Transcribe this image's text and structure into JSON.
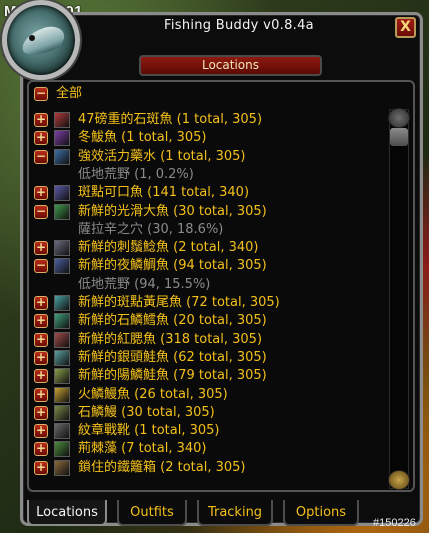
{
  "brand": "MOBILE01",
  "window": {
    "title": "Fishing Buddy v0.8.4a",
    "close_label": "X"
  },
  "header_bar": {
    "label": "Locations"
  },
  "top_group": {
    "toggle": "−",
    "label": "全部"
  },
  "rows": [
    {
      "toggle": "+",
      "label": "47磅重的石斑魚 (1 total, 305)",
      "icon_color": "#b23a3a"
    },
    {
      "toggle": "+",
      "label": "冬鮁魚 (1 total, 305)",
      "icon_color": "#7c3da8"
    },
    {
      "toggle": "−",
      "label": "強效活力藥水 (1 total, 305)",
      "icon_color": "#3e6fa8"
    },
    {
      "sub": true,
      "label": "低地荒野 (1, 0.2%)"
    },
    {
      "toggle": "+",
      "label": "斑點可口魚 (141 total, 340)",
      "icon_color": "#5a58a8"
    },
    {
      "toggle": "−",
      "label": "新鮮的光滑大魚 (30 total, 305)",
      "icon_color": "#3e9a4a"
    },
    {
      "sub": true,
      "label": "薩拉辛之穴 (30, 18.6%)"
    },
    {
      "toggle": "+",
      "label": "新鮮的刺鬚鯰魚 (2 total, 340)",
      "icon_color": "#6b6b80"
    },
    {
      "toggle": "−",
      "label": "新鮮的夜鱗鯛魚 (94 total, 305)",
      "icon_color": "#4a5ea0"
    },
    {
      "sub": true,
      "label": "低地荒野 (94, 15.5%)"
    },
    {
      "toggle": "+",
      "label": "新鮮的斑點黃尾魚 (72 total, 305)",
      "icon_color": "#4aa0a0"
    },
    {
      "toggle": "+",
      "label": "新鮮的石鱗鱈魚 (20 total, 305)",
      "icon_color": "#3ea07a"
    },
    {
      "toggle": "+",
      "label": "新鮮的紅腮魚 (318 total, 305)",
      "icon_color": "#a04a4a"
    },
    {
      "toggle": "+",
      "label": "新鮮的銀頭鮭魚 (62 total, 305)",
      "icon_color": "#5aa0a0"
    },
    {
      "toggle": "+",
      "label": "新鮮的陽鱗鮭魚 (79 total, 305)",
      "icon_color": "#8aa04a"
    },
    {
      "toggle": "+",
      "label": "火鱗鰻魚 (26 total, 305)",
      "icon_color": "#c8a030"
    },
    {
      "toggle": "+",
      "label": "石鱗鰻 (30 total, 305)",
      "icon_color": "#7a8a4a"
    },
    {
      "toggle": "+",
      "label": "紋章戰靴 (1 total, 305)",
      "icon_color": "#6a6a6a"
    },
    {
      "toggle": "+",
      "label": "荊棘藻 (7 total, 340)",
      "icon_color": "#4a8a3a"
    },
    {
      "toggle": "+",
      "label": "鎖住的鐵籬箱 (2 total, 305)",
      "icon_color": "#8a6a3a"
    }
  ],
  "tabs": [
    {
      "label": "Locations",
      "active": true
    },
    {
      "label": "Outfits",
      "active": false
    },
    {
      "label": "Tracking",
      "active": false
    },
    {
      "label": "Options",
      "active": false
    }
  ],
  "watermark": "#150226"
}
